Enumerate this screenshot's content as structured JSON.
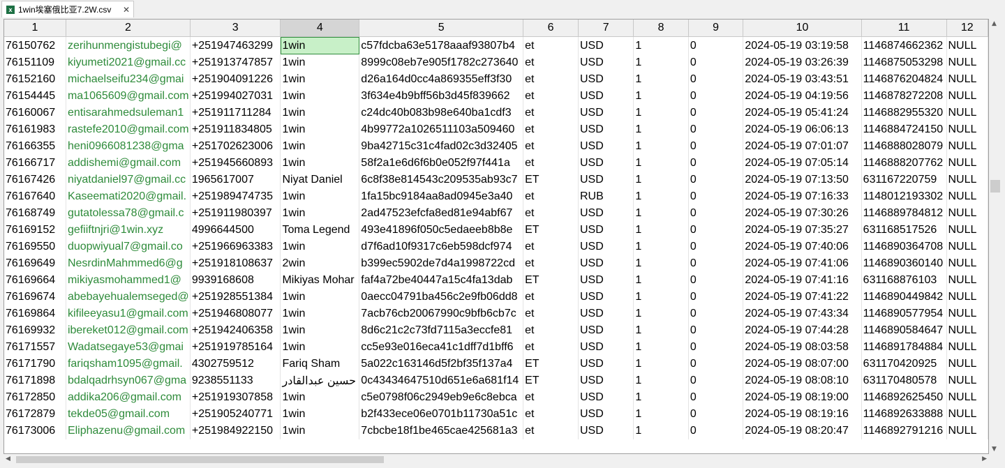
{
  "tab": {
    "title": "1win埃塞俄比亚7.2W.csv",
    "icon": "excel-file-icon",
    "close": "✕"
  },
  "columns": [
    "1",
    "2",
    "3",
    "4",
    "5",
    "6",
    "7",
    "8",
    "9",
    "10",
    "11",
    "12"
  ],
  "rows": [
    [
      "76150762",
      "zerihunmengistubegi@",
      "+251947463299",
      "1win",
      "c57fdcba63e5178aaaf93807b4",
      "et",
      "USD",
      "1",
      "0",
      "2024-05-19 03:19:58",
      "1146874662362",
      "NULL"
    ],
    [
      "76151109",
      "kiyumeti2021@gmail.cc",
      "+251913747857",
      "1win",
      "8999c08eb7e905f1782c273640",
      "et",
      "USD",
      "1",
      "0",
      "2024-05-19 03:26:39",
      "1146875053298",
      "NULL"
    ],
    [
      "76152160",
      "michaelseifu234@gmai",
      "+251904091226",
      "1win",
      "d26a164d0cc4a869355eff3f30",
      "et",
      "USD",
      "1",
      "0",
      "2024-05-19 03:43:51",
      "1146876204824",
      "NULL"
    ],
    [
      "76154445",
      "ma1065609@gmail.com",
      "+251994027031",
      "1win",
      "3f634e4b9bff56b3d45f839662",
      "et",
      "USD",
      "1",
      "0",
      "2024-05-19 04:19:56",
      "1146878272208",
      "NULL"
    ],
    [
      "76160067",
      "entisarahmedsuleman1",
      "+251911711284",
      "1win",
      "c24dc40b083b98e640ba1cdf3",
      "et",
      "USD",
      "1",
      "0",
      "2024-05-19 05:41:24",
      "1146882955320",
      "NULL"
    ],
    [
      "76161983",
      "rastefe2010@gmail.com",
      "+251911834805",
      "1win",
      "4b99772a1026511103a509460",
      "et",
      "USD",
      "1",
      "0",
      "2024-05-19 06:06:13",
      "1146884724150",
      "NULL"
    ],
    [
      "76166355",
      "heni0966081238@gma",
      "+251702623006",
      "1win",
      "9ba42715c31c4fad02c3d32405",
      "et",
      "USD",
      "1",
      "0",
      "2024-05-19 07:01:07",
      "1146888028079",
      "NULL"
    ],
    [
      "76166717",
      "addishemi@gmail.com",
      "+251945660893",
      "1win",
      "58f2a1e6d6f6b0e052f97f441a",
      "et",
      "USD",
      "1",
      "0",
      "2024-05-19 07:05:14",
      "1146888207762",
      "NULL"
    ],
    [
      "76167426",
      "niyatdaniel97@gmail.cc",
      "1965617007",
      "Niyat Daniel",
      "6c8f38e814543c209535ab93c7",
      "ET",
      "USD",
      "1",
      "0",
      "2024-05-19 07:13:50",
      "631167220759",
      "NULL"
    ],
    [
      "76167640",
      "Kaseemati2020@gmail.",
      "+251989474735",
      "1win",
      "1fa15bc9184aa8ad0945e3a40",
      "et",
      "RUB",
      "1",
      "0",
      "2024-05-19 07:16:33",
      "1148012193302",
      "NULL"
    ],
    [
      "76168749",
      "gutatolessa78@gmail.c",
      "+251911980397",
      "1win",
      "2ad47523efcfa8ed81e94abf67",
      "et",
      "USD",
      "1",
      "0",
      "2024-05-19 07:30:26",
      "1146889784812",
      "NULL"
    ],
    [
      "76169152",
      "gefiiftnjri@1win.xyz",
      "4996644500",
      "Toma Legend",
      "493e41896f050c5edaeeb8b8e",
      "ET",
      "USD",
      "1",
      "0",
      "2024-05-19 07:35:27",
      "631168517526",
      "NULL"
    ],
    [
      "76169550",
      "duopwiyual7@gmail.co",
      "+251966963383",
      "1win",
      "d7f6ad10f9317c6eb598dcf974",
      "et",
      "USD",
      "1",
      "0",
      "2024-05-19 07:40:06",
      "1146890364708",
      "NULL"
    ],
    [
      "76169649",
      "NesrdinMahmmed6@g",
      "+251918108637",
      "2win",
      "b399ec5902de7d4a1998722cd",
      "et",
      "USD",
      "1",
      "0",
      "2024-05-19 07:41:06",
      "1146890360140",
      "NULL"
    ],
    [
      "76169664",
      "mikiyasmohammed1@",
      "9939168608",
      "Mikiyas Mohar",
      "faf4a72be40447a15c4fa13dab",
      "ET",
      "USD",
      "1",
      "0",
      "2024-05-19 07:41:16",
      "631168876103",
      "NULL"
    ],
    [
      "76169674",
      "abebayehualemseged@",
      "+251928551384",
      "1win",
      "0aecc04791ba456c2e9fb06dd8",
      "et",
      "USD",
      "1",
      "0",
      "2024-05-19 07:41:22",
      "1146890449842",
      "NULL"
    ],
    [
      "76169864",
      "kifileeyasu1@gmail.com",
      "+251946808077",
      "1win",
      "7acb76cb20067990c9bfb6cb7c",
      "et",
      "USD",
      "1",
      "0",
      "2024-05-19 07:43:34",
      "1146890577954",
      "NULL"
    ],
    [
      "76169932",
      "ibereket012@gmail.com",
      "+251942406358",
      "1win",
      "8d6c21c2c73fd7115a3eccfe81",
      "et",
      "USD",
      "1",
      "0",
      "2024-05-19 07:44:28",
      "1146890584647",
      "NULL"
    ],
    [
      "76171557",
      "Wadatsegaye53@gmai",
      "+251919785164",
      "1win",
      "cc5e93e016eca41c1dff7d1bff6",
      "et",
      "USD",
      "1",
      "0",
      "2024-05-19 08:03:58",
      "1146891784884",
      "NULL"
    ],
    [
      "76171790",
      "fariqsham1095@gmail.",
      "4302759512",
      "Fariq Sham",
      "5a022c163146d5f2bf35f137a4",
      "ET",
      "USD",
      "1",
      "0",
      "2024-05-19 08:07:00",
      "631170420925",
      "NULL"
    ],
    [
      "76171898",
      "bdalqadrhsyn067@gma",
      "9238551133",
      "حسين عبدالقادر",
      "0c43434647510d651e6a681f14",
      "ET",
      "USD",
      "1",
      "0",
      "2024-05-19 08:08:10",
      "631170480578",
      "NULL"
    ],
    [
      "76172850",
      "addika206@gmail.com",
      "+251919307858",
      "1win",
      "c5e0798f06c2949eb9e6c8ebca",
      "et",
      "USD",
      "1",
      "0",
      "2024-05-19 08:19:00",
      "1146892625450",
      "NULL"
    ],
    [
      "76172879",
      "tekde05@gmail.com",
      "+251905240771",
      "1win",
      "b2f433ece06e0701b11730a51c",
      "et",
      "USD",
      "1",
      "0",
      "2024-05-19 08:19:16",
      "1146892633888",
      "NULL"
    ],
    [
      "76173006",
      "Eliphazenu@gmail.com",
      "+251984922150",
      "1win",
      "7cbcbe18f1be465cae425681a3",
      "et",
      "USD",
      "1",
      "0",
      "2024-05-19 08:20:47",
      "1146892791216",
      "NULL"
    ]
  ]
}
